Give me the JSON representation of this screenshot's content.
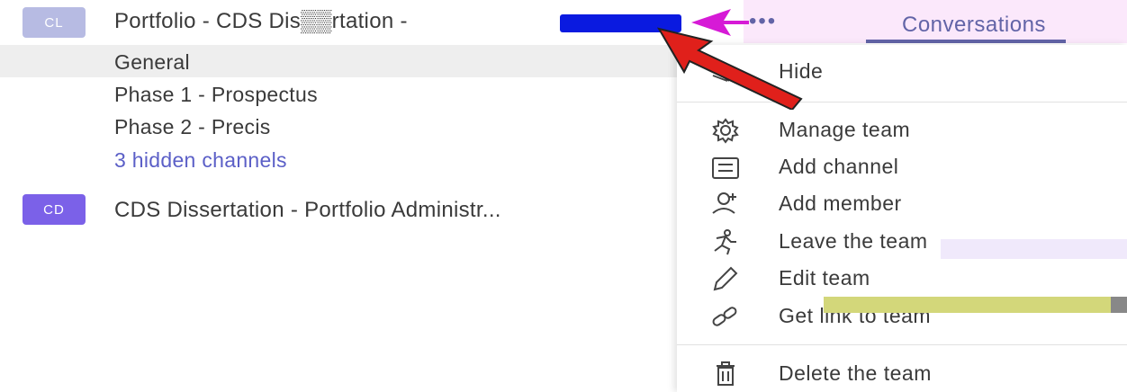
{
  "teams": [
    {
      "initials": "CL",
      "name": "Portfolio - CDS Dis▒▒rtation -",
      "avatar_color": "#b7bbe3",
      "channels": [
        {
          "label": "General"
        },
        {
          "label": "Phase 1 - Prospectus"
        },
        {
          "label": "Phase 2 - Precis"
        },
        {
          "label": "3 hidden channels"
        }
      ]
    },
    {
      "initials": "CD",
      "name": "CDS Dissertation - Portfolio Administr...",
      "avatar_color": "#7b61e8"
    }
  ],
  "header": {
    "more_options": "•••",
    "tab_label": "Conversations"
  },
  "context_menu": {
    "items": [
      {
        "label": "Hide",
        "icon": "hide-icon"
      },
      {
        "label": "Manage team",
        "icon": "gear-icon"
      },
      {
        "label": "Add channel",
        "icon": "channel-icon"
      },
      {
        "label": "Add member",
        "icon": "add-member-icon"
      },
      {
        "label": "Leave the team",
        "icon": "leave-icon"
      },
      {
        "label": "Edit team",
        "icon": "pencil-icon"
      },
      {
        "label": "Get link to team",
        "icon": "link-icon"
      },
      {
        "label": "Delete the team",
        "icon": "trash-icon"
      }
    ]
  },
  "colors": {
    "accent": "#6264a7",
    "annotation_red": "#e0201b",
    "annotation_magenta": "#d61ad6",
    "redaction_blue": "#0a1ae0"
  }
}
